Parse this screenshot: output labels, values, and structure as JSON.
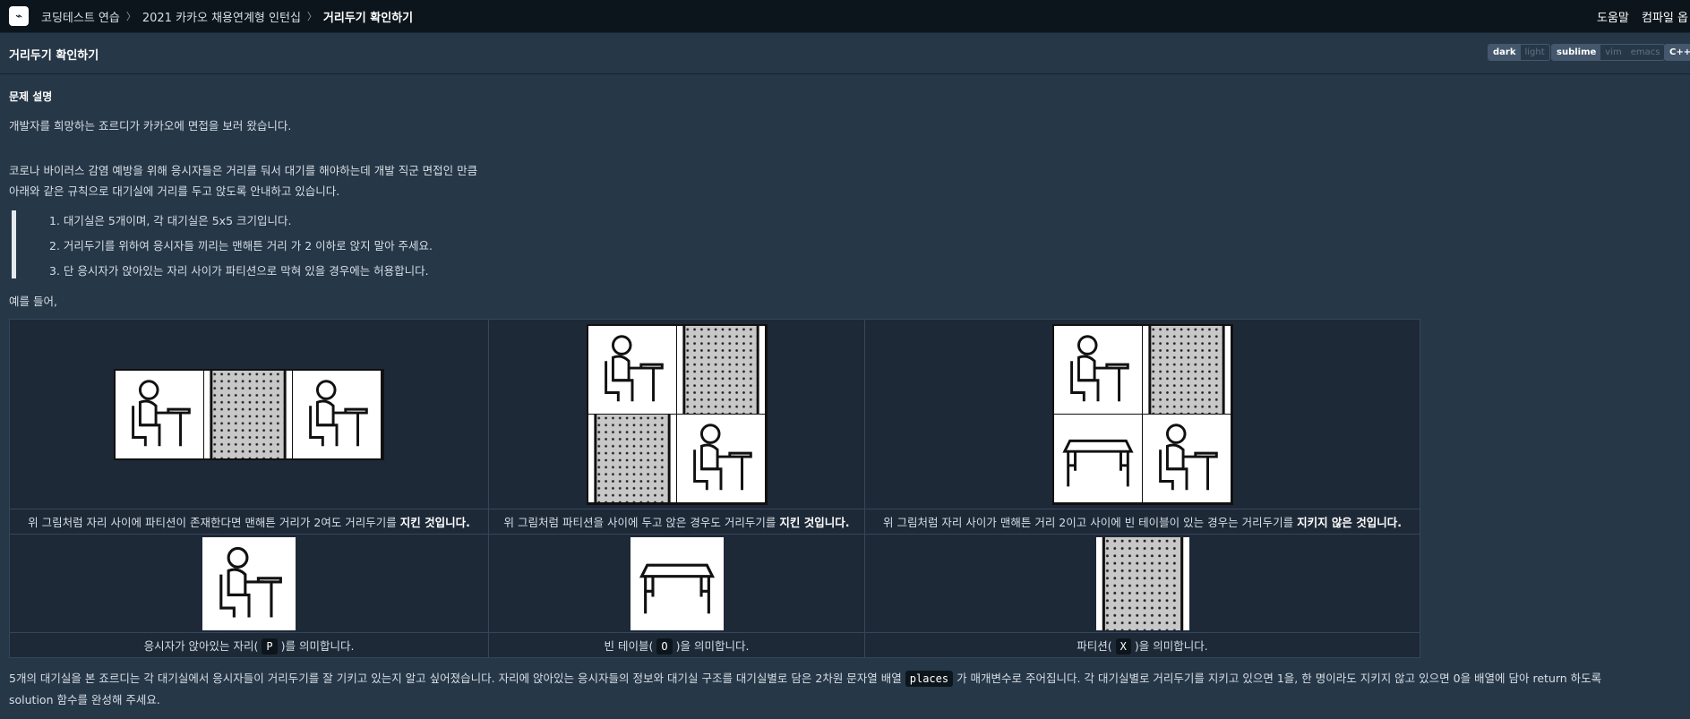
{
  "nav": {
    "crumbs": [
      "코딩테스트 연습",
      "2021 카카오 채용연계형 인턴십",
      "거리두기 확인하기"
    ],
    "help": "도움말",
    "compiler": "컴파일 옵"
  },
  "header": {
    "title": "거리두기 확인하기",
    "theme": [
      "dark",
      "light"
    ],
    "keymap": [
      "sublime",
      "vim",
      "emacs"
    ],
    "language": "C++"
  },
  "problem": {
    "section_title": "문제 설명",
    "intro": "개발자를 희망하는 죠르디가 카카오에 면접을 보러 왔습니다.",
    "line2": "코로나 바이러스 감염 예방을 위해 응시자들은 거리를 둬서 대기를 해야하는데 개발 직군 면접인 만큼",
    "line3": "아래와 같은 규칙으로 대기실에 거리를 두고 앉도록 안내하고 있습니다.",
    "rules": [
      "1. 대기실은 5개이며, 각 대기실은 5x5 크기입니다.",
      "2. 거리두기를 위하여 응시자들 끼리는 맨해튼 거리 가 2 이하로 앉지 말아 주세요.",
      "3. 단 응시자가 앉아있는 자리 사이가 파티션으로 막혀 있을 경우에는 허용합니다."
    ],
    "example": "예를 들어,",
    "captions": [
      {
        "pre": "위 그림처럼 자리 사이에 파티션이 존재한다면 맨해튼 거리가 2여도 거리두기를 ",
        "bold": "지킨 것입니다."
      },
      {
        "pre": "위 그림처럼 파티션을 사이에 두고 앉은 경우도 거리두기를 ",
        "bold": "지킨 것입니다."
      },
      {
        "pre": "위 그림처럼 자리 사이가 맨해튼 거리 2이고 사이에 빈 테이블이 있는 경우는 거리두기를 ",
        "bold": "지키지 않은 것입니다."
      }
    ],
    "legend": [
      {
        "pre": "응시자가 앉아있는 자리(",
        "code": "P",
        "post": ")를 의미합니다."
      },
      {
        "pre": "빈 테이블(",
        "code": "O",
        "post": ")을 의미합니다."
      },
      {
        "pre": "파티션(",
        "code": "X",
        "post": ")을 의미합니다."
      }
    ],
    "final1_pre": "5개의 대기실을 본 죠르디는 각 대기실에서 응시자들이 거리두기를 잘 기키고 있는지 알고 싶어졌습니다. 자리에 앉아있는 응시자들의 정보와 대기실 구조를 대기실별로 담은 2차원 문자열 배열 ",
    "final1_code": "places",
    "final1_post": " 가 매개변수로 주어집니다. 각 대기실별로 거리두기를 지키고 있으면 1을, 한 명이라도 지키지 않고 있으면 0을 배열에 담아 return 하도록",
    "final2": "solution 함수를 완성해 주세요."
  }
}
